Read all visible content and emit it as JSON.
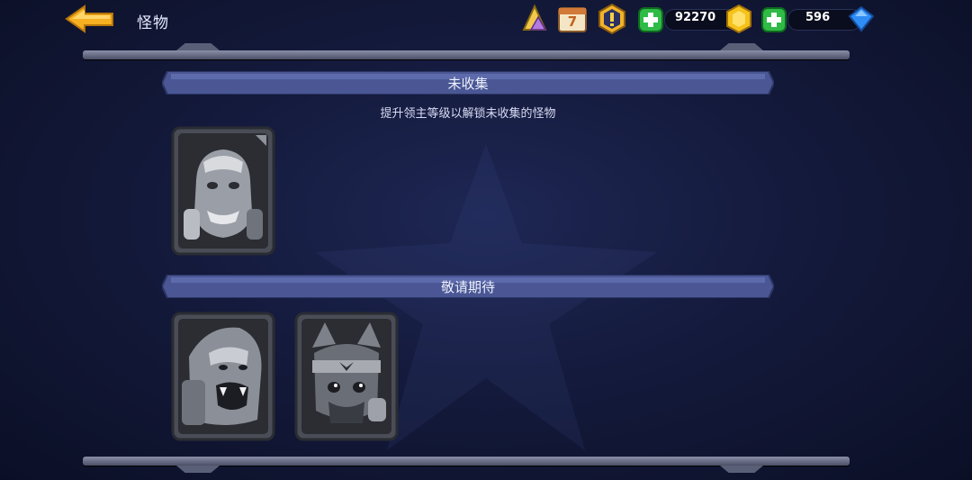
{
  "header": {
    "back_label": "back",
    "title": "怪物",
    "icons": [
      "summon-crystal-icon",
      "calendar-icon",
      "alert-badge-icon"
    ],
    "calendar_day": "7",
    "gold": {
      "value": "92270",
      "icon": "gold-coin-icon"
    },
    "gems": {
      "value": "596",
      "icon": "diamond-icon"
    }
  },
  "sections": [
    {
      "title": "未收集",
      "hint": "提升领主等级以解锁未收集的怪物",
      "cards": [
        {
          "name": "orc-warrior-portrait"
        }
      ]
    },
    {
      "title": "敬请期待",
      "cards": [
        {
          "name": "lion-beast-portrait"
        },
        {
          "name": "ninja-cat-portrait"
        }
      ]
    }
  ],
  "colors": {
    "banner": "#4a5794",
    "banner_edge": "#2c3566",
    "card_frame": "#6b6f7c",
    "gold": "#f5c31b",
    "gem": "#2f8cf5",
    "plus": "#2fbb46",
    "back_arrow": "#f6b021"
  }
}
